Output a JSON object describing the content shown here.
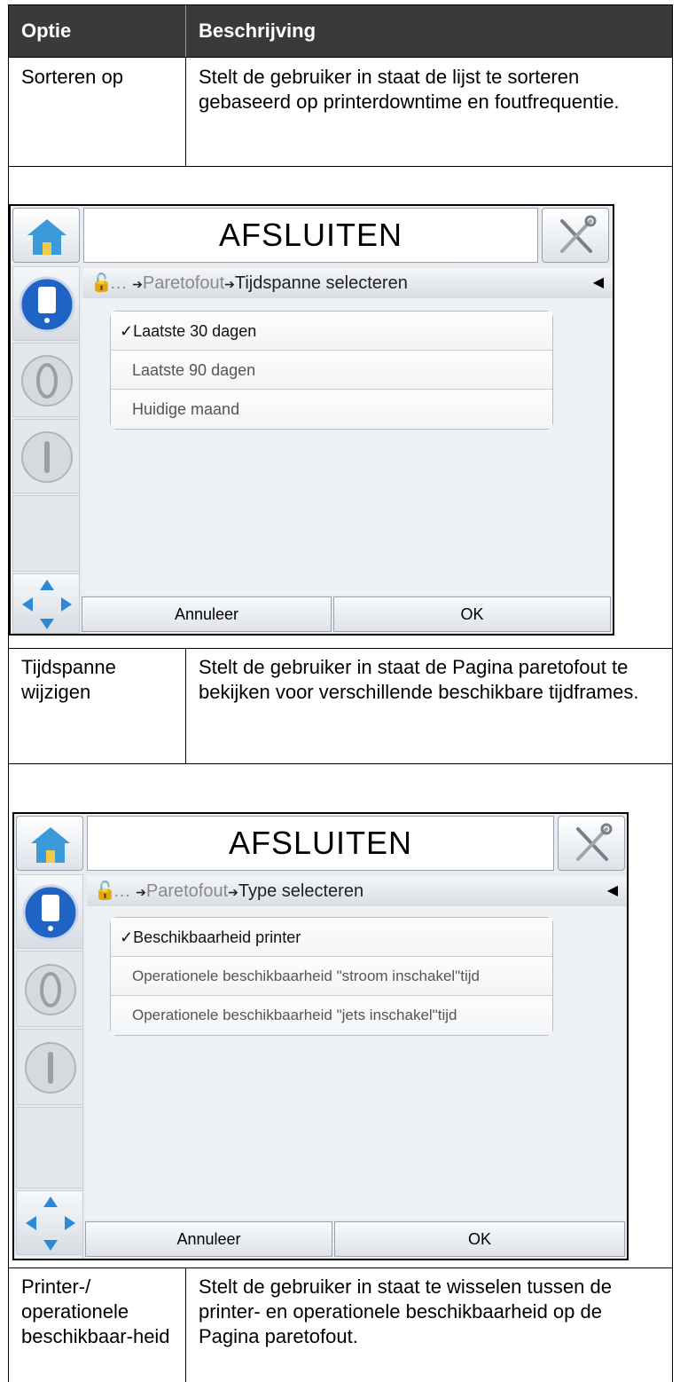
{
  "table": {
    "header": {
      "col1": "Optie",
      "col2": "Beschrijving"
    },
    "rows": [
      {
        "option": "Sorteren op",
        "description": "Stelt de gebruiker in staat de lijst te sorteren gebaseerd op printerdowntime en foutfrequentie."
      },
      {
        "option": "Tijdspanne wijzigen",
        "description": "Stelt de gebruiker in staat de Pagina paretofout te bekijken voor verschillende beschikbare tijdframes."
      },
      {
        "option": "Printer-/ operationele beschikbaar-heid",
        "description": "Stelt de gebruiker in staat te wisselen tussen de printer- en operationele beschikbaarheid op de Pagina paretofout."
      }
    ]
  },
  "screens": [
    {
      "title": "AFSLUITEN",
      "breadcrumb": {
        "ellipsis": "…",
        "parent": "Paretofout",
        "current": "Tijdspanne selecteren"
      },
      "options": [
        "Laatste 30 dagen",
        "Laatste 90 dagen",
        "Huidige maand"
      ],
      "selected_index": 0,
      "cancel_label": "Annuleer",
      "ok_label": "OK"
    },
    {
      "title": "AFSLUITEN",
      "breadcrumb": {
        "ellipsis": "…",
        "parent": "Paretofout",
        "current": "Type selecteren"
      },
      "options": [
        "Beschikbaarheid printer",
        "Operationele beschikbaarheid \"stroom inschakel\"tijd",
        "Operationele beschikbaarheid \"jets inschakel\"tijd"
      ],
      "selected_index": 0,
      "cancel_label": "Annuleer",
      "ok_label": "OK"
    }
  ],
  "glyphs": {
    "check": "✓",
    "arrow": "➔",
    "triangle": "◀"
  },
  "colors": {
    "header_bg": "#3a3a3a",
    "icon_blue": "#1f63c4"
  }
}
